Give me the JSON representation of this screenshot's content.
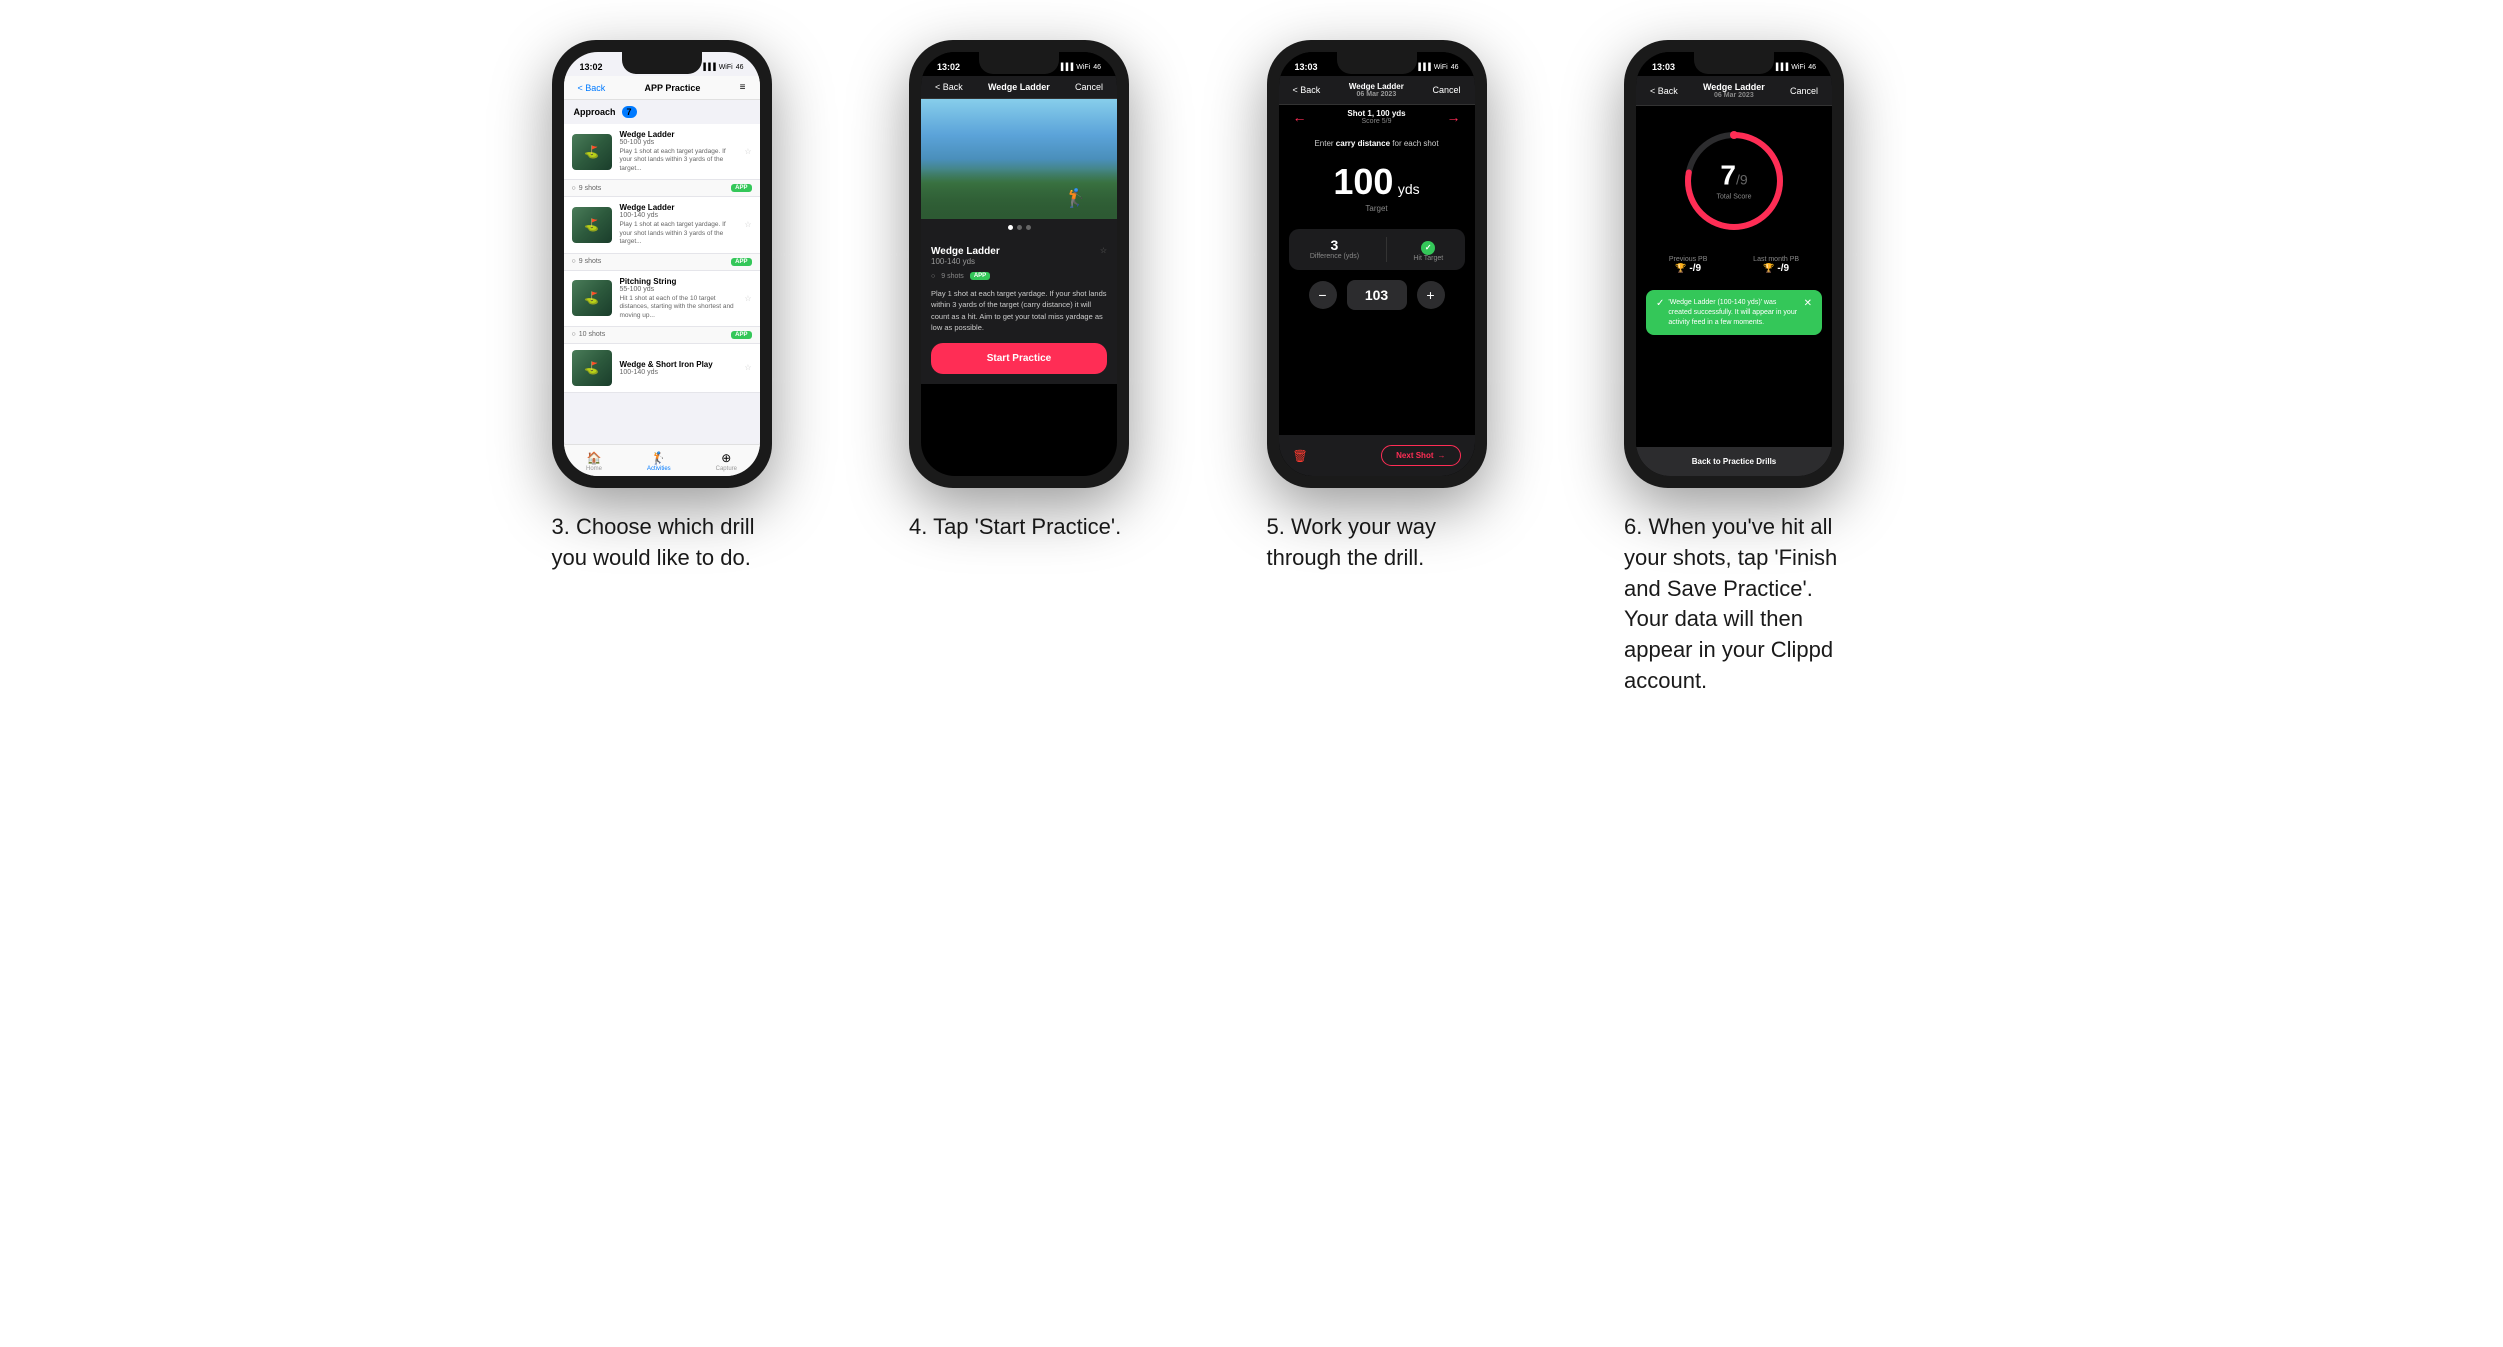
{
  "phones": [
    {
      "id": "phone1",
      "statusTime": "13:02",
      "navBack": "< Back",
      "navTitle": "APP Practice",
      "navRight": "≡",
      "sectionLabel": "Approach",
      "sectionCount": "7",
      "drills": [
        {
          "name": "Wedge Ladder",
          "yards": "50-100 yds",
          "desc": "Play 1 shot at each target yardage. If your shot lands within 3 yards of the target...",
          "shots": "9 shots",
          "badge": "APP"
        },
        {
          "name": "Wedge Ladder",
          "yards": "100-140 yds",
          "desc": "Play 1 shot at each target yardage. If your shot lands within 3 yards of the target...",
          "shots": "9 shots",
          "badge": "APP"
        },
        {
          "name": "Pitching String",
          "yards": "55-100 yds",
          "desc": "Hit 1 shot at each of the 10 target distances, starting with the shortest and moving up...",
          "shots": "10 shots",
          "badge": "APP"
        },
        {
          "name": "Wedge & Short Iron Play",
          "yards": "100-140 yds",
          "desc": "",
          "shots": "",
          "badge": ""
        }
      ],
      "bottomNav": [
        {
          "label": "Home",
          "icon": "🏠",
          "active": false
        },
        {
          "label": "Activities",
          "icon": "🏌️",
          "active": true
        },
        {
          "label": "Capture",
          "icon": "➕",
          "active": false
        }
      ]
    },
    {
      "id": "phone2",
      "statusTime": "13:02",
      "navBack": "< Back",
      "navTitle": "Wedge Ladder",
      "navRight": "Cancel",
      "imageDots": [
        true,
        false,
        false
      ],
      "drillName": "Wedge Ladder",
      "drillYards": "100-140 yds",
      "drillShots": "9 shots",
      "drillBadge": "APP",
      "drillDesc": "Play 1 shot at each target yardage. If your shot lands within 3 yards of the target (carry distance) it will count as a hit. Aim to get your total miss yardage as low as possible.",
      "startLabel": "Start Practice"
    },
    {
      "id": "phone3",
      "statusTime": "13:03",
      "navBack": "< Back",
      "navTitle": "Wedge Ladder",
      "navTitleSub": "06 Mar 2023",
      "navRight": "Cancel",
      "shotLabel": "Shot 1, 100 yds",
      "scoreLabel": "Score 5/9",
      "carryLabel": "Enter carry distance for each shot",
      "targetValue": "100",
      "targetUnit": "yds",
      "targetLabel": "Target",
      "difference": "3",
      "differenceLabel": "Difference (yds)",
      "hitTargetLabel": "Hit Target",
      "inputValue": "103",
      "nextShotLabel": "Next Shot"
    },
    {
      "id": "phone4",
      "statusTime": "13:03",
      "navBack": "< Back",
      "navTitle": "Wedge Ladder",
      "navTitleSub": "06 Mar 2023",
      "navRight": "Cancel",
      "scoreValue": "7",
      "scoreDenom": "/9",
      "scoreSublabel": "Total Score",
      "prevPBLabel": "Previous PB",
      "prevPBValue": "-/9",
      "lastMonthLabel": "Last month PB",
      "lastMonthValue": "-/9",
      "toastText": "'Wedge Ladder (100-140 yds)' was created successfully. It will appear in your activity feed in a few moments.",
      "backLabel": "Back to Practice Drills",
      "ringPercent": 78
    }
  ],
  "captions": [
    "3. Choose which drill you would like to do.",
    "4. Tap 'Start Practice'.",
    "5. Work your way through the drill.",
    "6. When you've hit all your shots, tap 'Finish and Save Practice'. Your data will then appear in your Clippd account."
  ],
  "colors": {
    "accent": "#ff2d55",
    "green": "#34c759",
    "blue": "#007aff",
    "dark": "#1c1c1e"
  }
}
